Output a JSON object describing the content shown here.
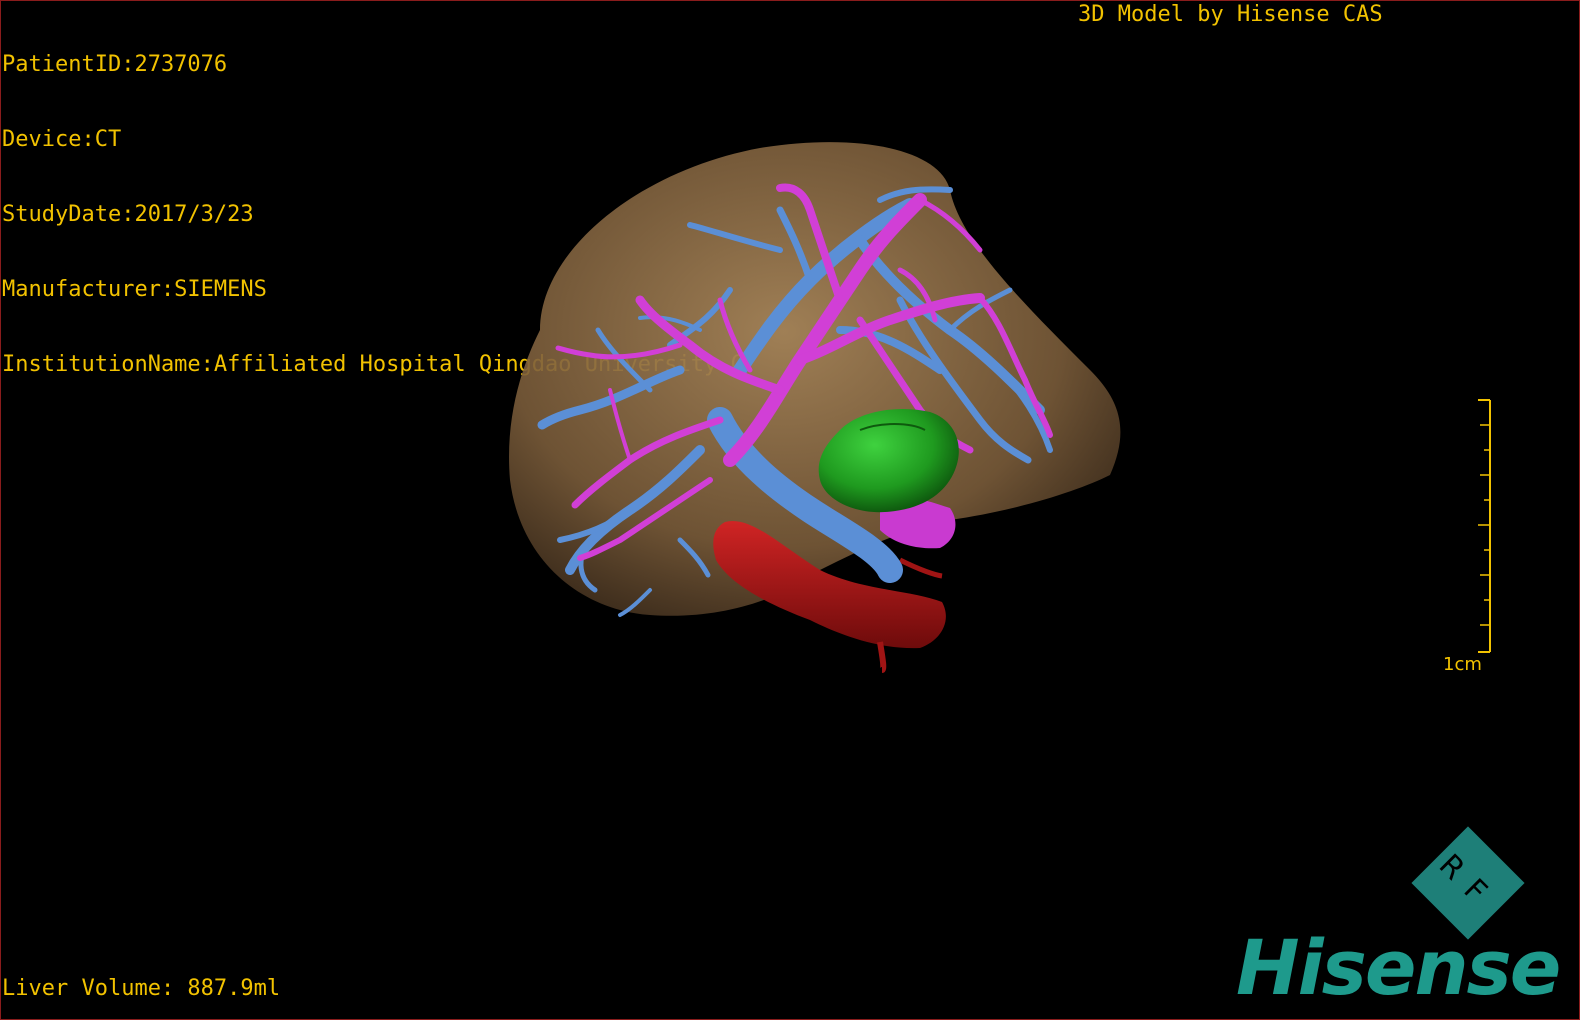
{
  "patient": {
    "patient_id": "PatientID:2737076",
    "device": "Device:CT",
    "study_date": "StudyDate:2017/3/23",
    "manufacturer": "Manufacturer:SIEMENS",
    "institution": "InstitutionName:Affiliated Hospital Qingdao University-C"
  },
  "title": "3D Model by Hisense CAS",
  "liver_volume": "Liver Volume: 887.9ml",
  "scale": {
    "label": "1cm"
  },
  "logo": {
    "badge": "RF",
    "brand": "Hisense"
  },
  "colors": {
    "overlay_text": "#f2c200",
    "liver": "#8a6a44",
    "portal_vein": "#5b8fd6",
    "hepatic_vein": "#d13fd6",
    "tumor": "#1f9a1f",
    "vena_cava": "#b01818",
    "brand": "#1e9a8c"
  }
}
